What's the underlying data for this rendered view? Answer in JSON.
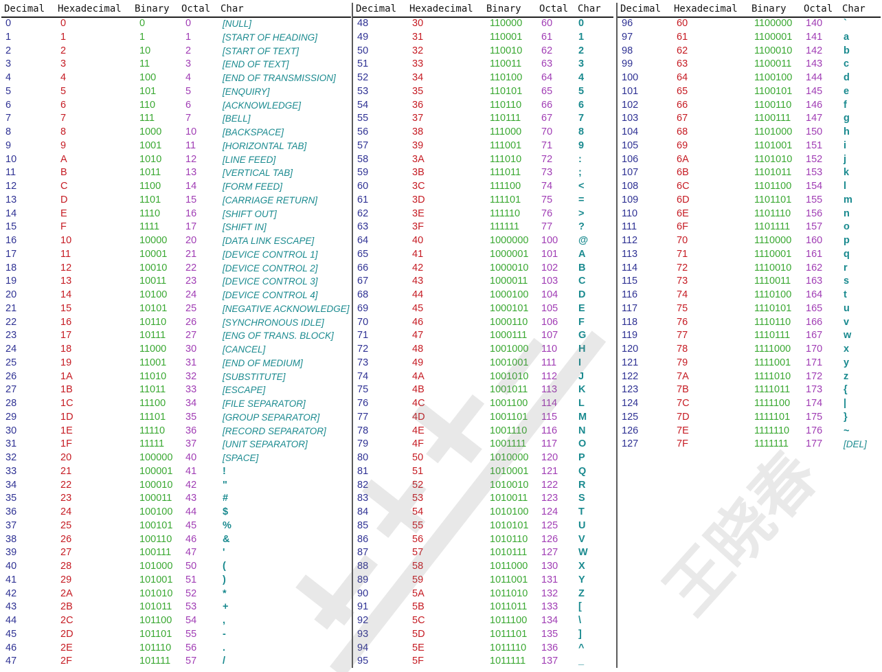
{
  "headers": [
    "Decimal",
    "Hexadecimal",
    "Binary",
    "Octal",
    "Char"
  ],
  "colors": {
    "decimal": "#2e3193",
    "hex": "#c51a22",
    "binary": "#3aa832",
    "octal": "#a03cb4",
    "char": "#1a8a8f"
  },
  "watermark": {
    "icon": "watermark-logo-icon",
    "text": "王晓春"
  },
  "columns": [
    [
      [
        "0",
        "0",
        "0",
        "0",
        "[NULL]",
        1
      ],
      [
        "1",
        "1",
        "1",
        "1",
        "[START OF HEADING]",
        1
      ],
      [
        "2",
        "2",
        "10",
        "2",
        "[START OF TEXT]",
        1
      ],
      [
        "3",
        "3",
        "11",
        "3",
        "[END OF TEXT]",
        1
      ],
      [
        "4",
        "4",
        "100",
        "4",
        "[END OF TRANSMISSION]",
        1
      ],
      [
        "5",
        "5",
        "101",
        "5",
        "[ENQUIRY]",
        1
      ],
      [
        "6",
        "6",
        "110",
        "6",
        "[ACKNOWLEDGE]",
        1
      ],
      [
        "7",
        "7",
        "111",
        "7",
        "[BELL]",
        1
      ],
      [
        "8",
        "8",
        "1000",
        "10",
        "[BACKSPACE]",
        1
      ],
      [
        "9",
        "9",
        "1001",
        "11",
        "[HORIZONTAL TAB]",
        1
      ],
      [
        "10",
        "A",
        "1010",
        "12",
        "[LINE FEED]",
        1
      ],
      [
        "11",
        "B",
        "1011",
        "13",
        "[VERTICAL TAB]",
        1
      ],
      [
        "12",
        "C",
        "1100",
        "14",
        "[FORM FEED]",
        1
      ],
      [
        "13",
        "D",
        "1101",
        "15",
        "[CARRIAGE RETURN]",
        1
      ],
      [
        "14",
        "E",
        "1110",
        "16",
        "[SHIFT OUT]",
        1
      ],
      [
        "15",
        "F",
        "1111",
        "17",
        "[SHIFT IN]",
        1
      ],
      [
        "16",
        "10",
        "10000",
        "20",
        "[DATA LINK ESCAPE]",
        1
      ],
      [
        "17",
        "11",
        "10001",
        "21",
        "[DEVICE CONTROL 1]",
        1
      ],
      [
        "18",
        "12",
        "10010",
        "22",
        "[DEVICE CONTROL 2]",
        1
      ],
      [
        "19",
        "13",
        "10011",
        "23",
        "[DEVICE CONTROL 3]",
        1
      ],
      [
        "20",
        "14",
        "10100",
        "24",
        "[DEVICE CONTROL 4]",
        1
      ],
      [
        "21",
        "15",
        "10101",
        "25",
        "[NEGATIVE ACKNOWLEDGE]",
        1
      ],
      [
        "22",
        "16",
        "10110",
        "26",
        "[SYNCHRONOUS IDLE]",
        1
      ],
      [
        "23",
        "17",
        "10111",
        "27",
        "[ENG OF TRANS. BLOCK]",
        1
      ],
      [
        "24",
        "18",
        "11000",
        "30",
        "[CANCEL]",
        1
      ],
      [
        "25",
        "19",
        "11001",
        "31",
        "[END OF MEDIUM]",
        1
      ],
      [
        "26",
        "1A",
        "11010",
        "32",
        "[SUBSTITUTE]",
        1
      ],
      [
        "27",
        "1B",
        "11011",
        "33",
        "[ESCAPE]",
        1
      ],
      [
        "28",
        "1C",
        "11100",
        "34",
        "[FILE SEPARATOR]",
        1
      ],
      [
        "29",
        "1D",
        "11101",
        "35",
        "[GROUP SEPARATOR]",
        1
      ],
      [
        "30",
        "1E",
        "11110",
        "36",
        "[RECORD SEPARATOR]",
        1
      ],
      [
        "31",
        "1F",
        "11111",
        "37",
        "[UNIT SEPARATOR]",
        1
      ],
      [
        "32",
        "20",
        "100000",
        "40",
        "[SPACE]",
        1
      ],
      [
        "33",
        "21",
        "100001",
        "41",
        "!",
        0
      ],
      [
        "34",
        "22",
        "100010",
        "42",
        "\"",
        0
      ],
      [
        "35",
        "23",
        "100011",
        "43",
        "#",
        0
      ],
      [
        "36",
        "24",
        "100100",
        "44",
        "$",
        0
      ],
      [
        "37",
        "25",
        "100101",
        "45",
        "%",
        0
      ],
      [
        "38",
        "26",
        "100110",
        "46",
        "&",
        0
      ],
      [
        "39",
        "27",
        "100111",
        "47",
        "'",
        0
      ],
      [
        "40",
        "28",
        "101000",
        "50",
        "(",
        0
      ],
      [
        "41",
        "29",
        "101001",
        "51",
        ")",
        0
      ],
      [
        "42",
        "2A",
        "101010",
        "52",
        "*",
        0
      ],
      [
        "43",
        "2B",
        "101011",
        "53",
        "+",
        0
      ],
      [
        "44",
        "2C",
        "101100",
        "54",
        ",",
        0
      ],
      [
        "45",
        "2D",
        "101101",
        "55",
        "-",
        0
      ],
      [
        "46",
        "2E",
        "101110",
        "56",
        ".",
        0
      ],
      [
        "47",
        "2F",
        "101111",
        "57",
        "/",
        0
      ]
    ],
    [
      [
        "48",
        "30",
        "110000",
        "60",
        "0",
        0
      ],
      [
        "49",
        "31",
        "110001",
        "61",
        "1",
        0
      ],
      [
        "50",
        "32",
        "110010",
        "62",
        "2",
        0
      ],
      [
        "51",
        "33",
        "110011",
        "63",
        "3",
        0
      ],
      [
        "52",
        "34",
        "110100",
        "64",
        "4",
        0
      ],
      [
        "53",
        "35",
        "110101",
        "65",
        "5",
        0
      ],
      [
        "54",
        "36",
        "110110",
        "66",
        "6",
        0
      ],
      [
        "55",
        "37",
        "110111",
        "67",
        "7",
        0
      ],
      [
        "56",
        "38",
        "111000",
        "70",
        "8",
        0
      ],
      [
        "57",
        "39",
        "111001",
        "71",
        "9",
        0
      ],
      [
        "58",
        "3A",
        "111010",
        "72",
        ":",
        0
      ],
      [
        "59",
        "3B",
        "111011",
        "73",
        ";",
        0
      ],
      [
        "60",
        "3C",
        "111100",
        "74",
        "<",
        0
      ],
      [
        "61",
        "3D",
        "111101",
        "75",
        "=",
        0
      ],
      [
        "62",
        "3E",
        "111110",
        "76",
        ">",
        0
      ],
      [
        "63",
        "3F",
        "111111",
        "77",
        "?",
        0
      ],
      [
        "64",
        "40",
        "1000000",
        "100",
        "@",
        0
      ],
      [
        "65",
        "41",
        "1000001",
        "101",
        "A",
        0
      ],
      [
        "66",
        "42",
        "1000010",
        "102",
        "B",
        0
      ],
      [
        "67",
        "43",
        "1000011",
        "103",
        "C",
        0
      ],
      [
        "68",
        "44",
        "1000100",
        "104",
        "D",
        0
      ],
      [
        "69",
        "45",
        "1000101",
        "105",
        "E",
        0
      ],
      [
        "70",
        "46",
        "1000110",
        "106",
        "F",
        0
      ],
      [
        "71",
        "47",
        "1000111",
        "107",
        "G",
        0
      ],
      [
        "72",
        "48",
        "1001000",
        "110",
        "H",
        0
      ],
      [
        "73",
        "49",
        "1001001",
        "111",
        "I",
        0
      ],
      [
        "74",
        "4A",
        "1001010",
        "112",
        "J",
        0
      ],
      [
        "75",
        "4B",
        "1001011",
        "113",
        "K",
        0
      ],
      [
        "76",
        "4C",
        "1001100",
        "114",
        "L",
        0
      ],
      [
        "77",
        "4D",
        "1001101",
        "115",
        "M",
        0
      ],
      [
        "78",
        "4E",
        "1001110",
        "116",
        "N",
        0
      ],
      [
        "79",
        "4F",
        "1001111",
        "117",
        "O",
        0
      ],
      [
        "80",
        "50",
        "1010000",
        "120",
        "P",
        0
      ],
      [
        "81",
        "51",
        "1010001",
        "121",
        "Q",
        0
      ],
      [
        "82",
        "52",
        "1010010",
        "122",
        "R",
        0
      ],
      [
        "83",
        "53",
        "1010011",
        "123",
        "S",
        0
      ],
      [
        "84",
        "54",
        "1010100",
        "124",
        "T",
        0
      ],
      [
        "85",
        "55",
        "1010101",
        "125",
        "U",
        0
      ],
      [
        "86",
        "56",
        "1010110",
        "126",
        "V",
        0
      ],
      [
        "87",
        "57",
        "1010111",
        "127",
        "W",
        0
      ],
      [
        "88",
        "58",
        "1011000",
        "130",
        "X",
        0
      ],
      [
        "89",
        "59",
        "1011001",
        "131",
        "Y",
        0
      ],
      [
        "90",
        "5A",
        "1011010",
        "132",
        "Z",
        0
      ],
      [
        "91",
        "5B",
        "1011011",
        "133",
        "[",
        0
      ],
      [
        "92",
        "5C",
        "1011100",
        "134",
        "\\",
        0
      ],
      [
        "93",
        "5D",
        "1011101",
        "135",
        "]",
        0
      ],
      [
        "94",
        "5E",
        "1011110",
        "136",
        "^",
        0
      ],
      [
        "95",
        "5F",
        "1011111",
        "137",
        "_",
        0
      ]
    ],
    [
      [
        "96",
        "60",
        "1100000",
        "140",
        "`",
        0
      ],
      [
        "97",
        "61",
        "1100001",
        "141",
        "a",
        0
      ],
      [
        "98",
        "62",
        "1100010",
        "142",
        "b",
        0
      ],
      [
        "99",
        "63",
        "1100011",
        "143",
        "c",
        0
      ],
      [
        "100",
        "64",
        "1100100",
        "144",
        "d",
        0
      ],
      [
        "101",
        "65",
        "1100101",
        "145",
        "e",
        0
      ],
      [
        "102",
        "66",
        "1100110",
        "146",
        "f",
        0
      ],
      [
        "103",
        "67",
        "1100111",
        "147",
        "g",
        0
      ],
      [
        "104",
        "68",
        "1101000",
        "150",
        "h",
        0
      ],
      [
        "105",
        "69",
        "1101001",
        "151",
        "i",
        0
      ],
      [
        "106",
        "6A",
        "1101010",
        "152",
        "j",
        0
      ],
      [
        "107",
        "6B",
        "1101011",
        "153",
        "k",
        0
      ],
      [
        "108",
        "6C",
        "1101100",
        "154",
        "l",
        0
      ],
      [
        "109",
        "6D",
        "1101101",
        "155",
        "m",
        0
      ],
      [
        "110",
        "6E",
        "1101110",
        "156",
        "n",
        0
      ],
      [
        "111",
        "6F",
        "1101111",
        "157",
        "o",
        0
      ],
      [
        "112",
        "70",
        "1110000",
        "160",
        "p",
        0
      ],
      [
        "113",
        "71",
        "1110001",
        "161",
        "q",
        0
      ],
      [
        "114",
        "72",
        "1110010",
        "162",
        "r",
        0
      ],
      [
        "115",
        "73",
        "1110011",
        "163",
        "s",
        0
      ],
      [
        "116",
        "74",
        "1110100",
        "164",
        "t",
        0
      ],
      [
        "117",
        "75",
        "1110101",
        "165",
        "u",
        0
      ],
      [
        "118",
        "76",
        "1110110",
        "166",
        "v",
        0
      ],
      [
        "119",
        "77",
        "1110111",
        "167",
        "w",
        0
      ],
      [
        "120",
        "78",
        "1111000",
        "170",
        "x",
        0
      ],
      [
        "121",
        "79",
        "1111001",
        "171",
        "y",
        0
      ],
      [
        "122",
        "7A",
        "1111010",
        "172",
        "z",
        0
      ],
      [
        "123",
        "7B",
        "1111011",
        "173",
        "{",
        0
      ],
      [
        "124",
        "7C",
        "1111100",
        "174",
        "|",
        0
      ],
      [
        "125",
        "7D",
        "1111101",
        "175",
        "}",
        0
      ],
      [
        "126",
        "7E",
        "1111110",
        "176",
        "~",
        0
      ],
      [
        "127",
        "7F",
        "1111111",
        "177",
        "[DEL]",
        1
      ]
    ]
  ]
}
